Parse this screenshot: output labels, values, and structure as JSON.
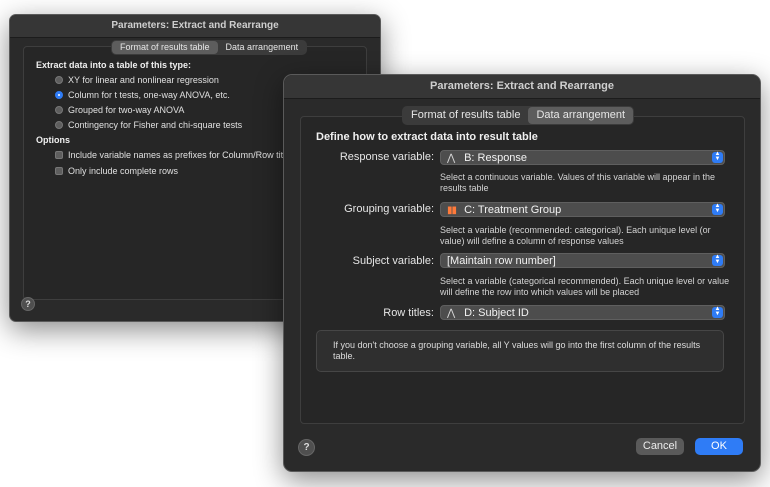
{
  "back_window": {
    "title": "Parameters: Extract and Rearrange",
    "tabs": [
      "Format of results table",
      "Data arrangement"
    ],
    "extract_heading": "Extract data into a table of this type:",
    "radio_options": [
      "XY for linear and nonlinear regression",
      "Column for t tests, one-way ANOVA, etc.",
      "Grouped for two-way ANOVA",
      "Contingency for Fisher and chi-square tests"
    ],
    "selected_radio": 1,
    "options_heading": "Options",
    "checkbox_options": [
      "Include variable names as prefixes for Column/Row titles",
      "Only include complete rows"
    ],
    "help": "?"
  },
  "front_window": {
    "title": "Parameters: Extract and Rearrange",
    "tabs": [
      "Format of results table",
      "Data arrangement"
    ],
    "active_tab": 1,
    "heading": "Define how to extract  data into result table",
    "fields": [
      {
        "label": "Response variable:",
        "icon": "continuous-variable-icon",
        "icon_glyph": "⋀",
        "value": "B: Response",
        "help": "Select a continuous variable. Values of this variable will appear in the results table"
      },
      {
        "label": "Grouping variable:",
        "icon": "categorical-variable-icon",
        "icon_glyph": "▮▮",
        "value": "C: Treatment Group",
        "help": "Select a variable (recommended: categorical). Each unique level (or value) will define a column of response values"
      },
      {
        "label": "Subject variable:",
        "icon": "",
        "icon_glyph": "",
        "value": "[Maintain row number]",
        "help": "Select a variable (categorical recommended). Each unique level or value will define the row into which values will be placed"
      },
      {
        "label": "Row titles:",
        "icon": "continuous-variable-icon",
        "icon_glyph": "⋀",
        "value": "D: Subject ID",
        "help": ""
      }
    ],
    "note": "If you don't choose a grouping variable, all Y values will go into the first column of the results table.",
    "buttons": {
      "cancel": "Cancel",
      "ok": "OK"
    },
    "help": "?"
  },
  "colors": {
    "accent": "#2f7cf6",
    "window_bg": "#2a2a2a",
    "bar_icon": "#ff7a3a"
  }
}
